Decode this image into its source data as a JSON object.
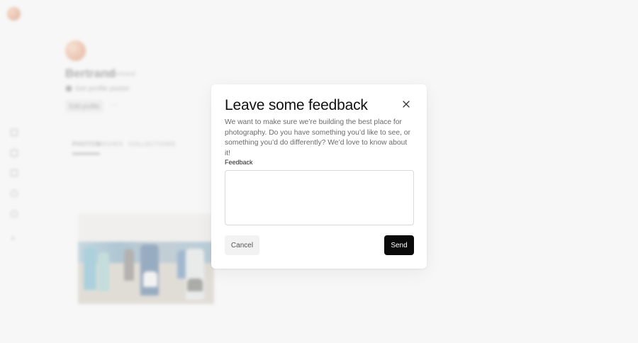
{
  "background": {
    "profile": {
      "name": "Bertrand",
      "handle": "@bertrand",
      "link_text": "Get profile poster",
      "edit_button": "Edit profile",
      "more_label": "···"
    },
    "tabs": [
      {
        "label": "PHOTOS"
      },
      {
        "label": "MOVIES"
      },
      {
        "label": "COLLECTIONS"
      }
    ],
    "sidebar_icons": [
      "home-icon",
      "layout-icon",
      "tag-icon",
      "info-icon",
      "search-icon",
      "plus-icon"
    ]
  },
  "modal": {
    "title": "Leave some feedback",
    "description": "We want to make sure we’re building the best place for photography. Do you have something you’d like to see, or something you’d do differently? We’d love to know about it!",
    "field_label": "Feedback",
    "feedback_value": "",
    "feedback_placeholder": "",
    "cancel_label": "Cancel",
    "send_label": "Send",
    "close_icon": "close-icon"
  },
  "colors": {
    "send_bg": "#0a0a0a",
    "cancel_bg": "#f2f2f2",
    "page_bg": "#f7f7f7"
  }
}
